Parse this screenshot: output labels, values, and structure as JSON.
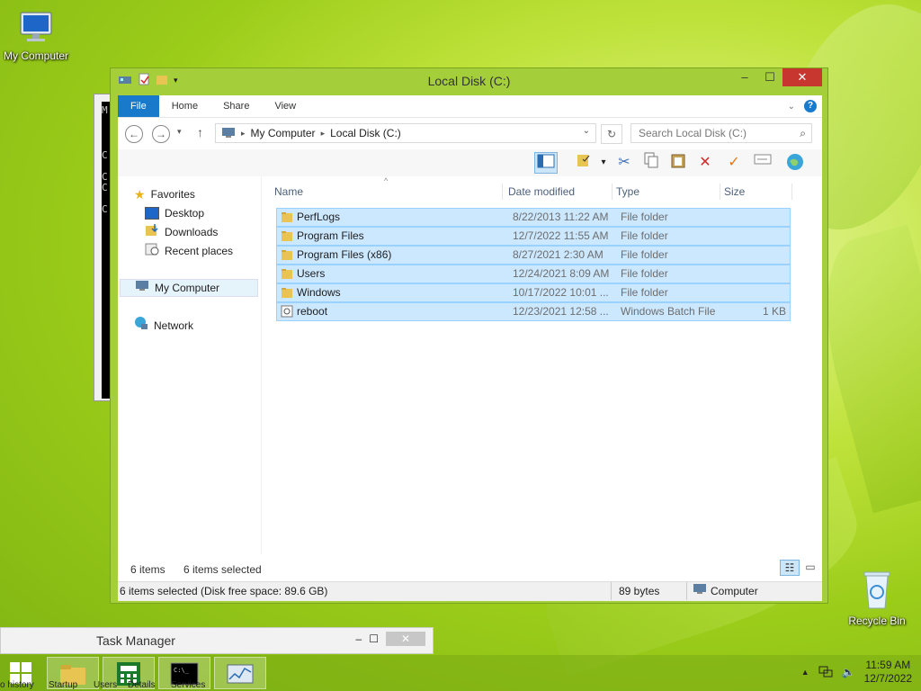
{
  "desktop": {
    "my_computer_label": "My Computer",
    "recycle_bin_label": "Recycle Bin"
  },
  "console": {
    "lines": [
      "M",
      "C",
      "C",
      "C",
      "C"
    ]
  },
  "explorer": {
    "title": "Local Disk (C:)",
    "ribbon_tabs": [
      "File",
      "Home",
      "Share",
      "View"
    ],
    "breadcrumb": [
      "My Computer",
      "Local Disk (C:)"
    ],
    "search_placeholder": "Search Local Disk (C:)",
    "nav": {
      "favorites": "Favorites",
      "desktop": "Desktop",
      "downloads": "Downloads",
      "recent": "Recent places",
      "computer": "My Computer",
      "network": "Network"
    },
    "columns": [
      "Name",
      "Date modified",
      "Type",
      "Size"
    ],
    "rows": [
      {
        "name": "PerfLogs",
        "date": "8/22/2013 11:22 AM",
        "type": "File folder",
        "size": ""
      },
      {
        "name": "Program Files",
        "date": "12/7/2022 11:55 AM",
        "type": "File folder",
        "size": ""
      },
      {
        "name": "Program Files (x86)",
        "date": "8/27/2021 2:30 AM",
        "type": "File folder",
        "size": ""
      },
      {
        "name": "Users",
        "date": "12/24/2021 8:09 AM",
        "type": "File folder",
        "size": ""
      },
      {
        "name": "Windows",
        "date": "10/17/2022 10:01 ...",
        "type": "File folder",
        "size": ""
      },
      {
        "name": "reboot",
        "date": "12/23/2021 12:58 ...",
        "type": "Windows Batch File",
        "size": "1 KB"
      }
    ],
    "item_count": "6 items",
    "selected_count": "6 items selected",
    "status_selection": "6 items selected (Disk free space: 89.6 GB)",
    "status_bytes": "89 bytes",
    "status_location": "Computer"
  },
  "task_manager": {
    "title": "Task Manager",
    "tabs": [
      "o history",
      "Startup",
      "Users",
      "Details",
      "Services"
    ]
  },
  "clock": {
    "time": "11:59 AM",
    "date": "12/7/2022"
  },
  "colors": {
    "accent": "#1979ca",
    "selection": "#cce8ff",
    "window_frame": "#a4cf3a"
  }
}
